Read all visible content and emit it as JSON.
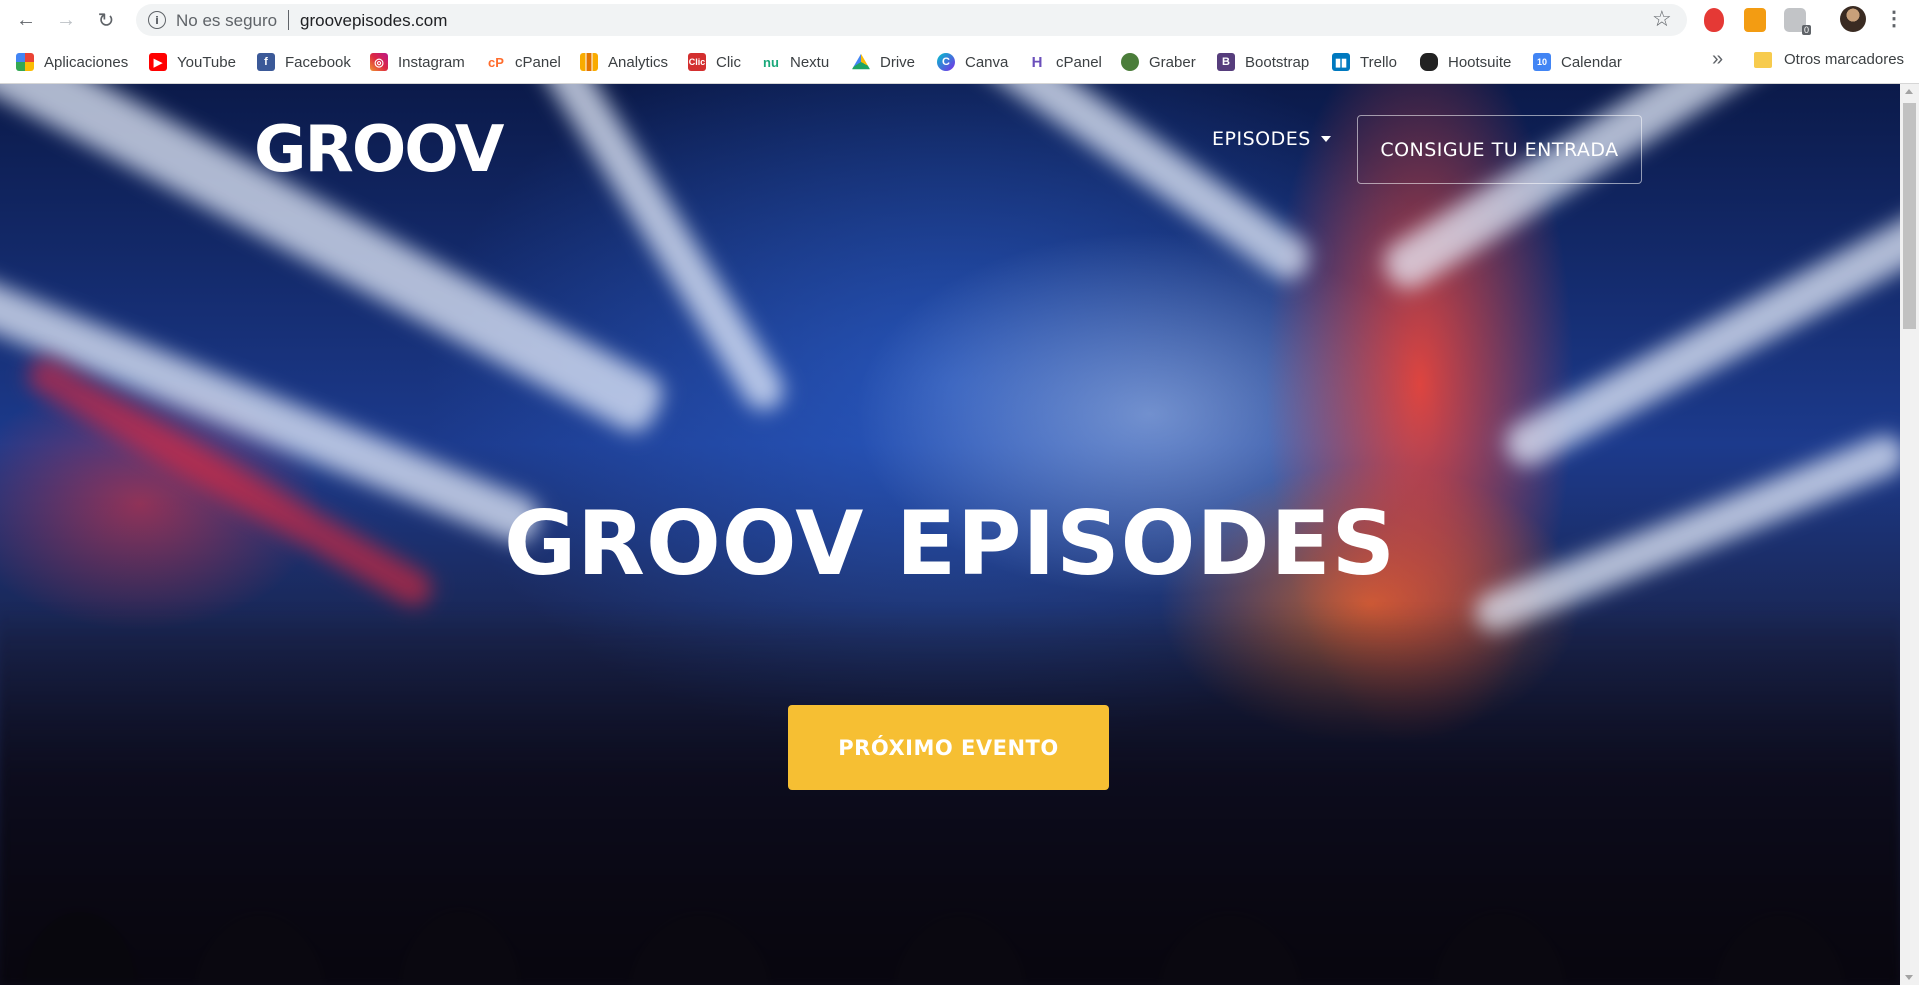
{
  "browser": {
    "security_label": "No es seguro",
    "url": "groovepisodes.com",
    "extension_badge": "0",
    "bookmarks": [
      {
        "label": "Aplicaciones",
        "icon": "apps-grid-icon",
        "color": "#4285f4"
      },
      {
        "label": "YouTube",
        "icon": "youtube-icon",
        "color": "#ff0000"
      },
      {
        "label": "Facebook",
        "icon": "facebook-icon",
        "color": "#3b5998"
      },
      {
        "label": "Instagram",
        "icon": "instagram-icon",
        "color": "#c13584"
      },
      {
        "label": "cPanel",
        "icon": "cpanel-icon",
        "color": "#ff6c2c"
      },
      {
        "label": "Analytics",
        "icon": "analytics-icon",
        "color": "#f9ab00"
      },
      {
        "label": "Clic",
        "icon": "clic-icon",
        "color": "#d32f2f"
      },
      {
        "label": "Nextu",
        "icon": "nextu-icon",
        "color": "#1aa87a"
      },
      {
        "label": "Drive",
        "icon": "drive-icon",
        "color": "#1fa463"
      },
      {
        "label": "Canva",
        "icon": "canva-icon",
        "color": "#00c4cc"
      },
      {
        "label": "cPanel",
        "icon": "cpanel-h-icon",
        "color": "#6b4fbb"
      },
      {
        "label": "Graber",
        "icon": "graber-icon",
        "color": "#4b7d3a"
      },
      {
        "label": "Bootstrap",
        "icon": "bootstrap-icon",
        "color": "#563d7c"
      },
      {
        "label": "Trello",
        "icon": "trello-icon",
        "color": "#0079bf"
      },
      {
        "label": "Hootsuite",
        "icon": "hootsuite-icon",
        "color": "#222222"
      },
      {
        "label": "Calendar",
        "icon": "calendar-icon",
        "color": "#4285f4"
      }
    ],
    "more_bookmarks": "»",
    "other_bookmarks": "Otros marcadores"
  },
  "page": {
    "logo": "GROOV",
    "nav": {
      "episodes": "EPISODES",
      "ticket": "CONSIGUE TU ENTRADA"
    },
    "hero": {
      "title": "GROOV EPISODES",
      "cta": "PRÓXIMO EVENTO"
    },
    "colors": {
      "accent": "#f6bf33",
      "text": "#ffffff"
    }
  }
}
